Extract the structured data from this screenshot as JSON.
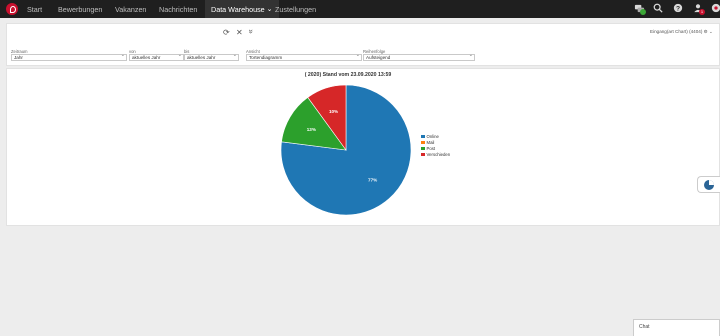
{
  "nav": {
    "items": [
      "Start",
      "Bewerbungen",
      "Vakanzen",
      "Nachrichten",
      "Data Warehouse",
      "Zustellungen"
    ],
    "active_suffix": "⌄"
  },
  "topbar_icons": {
    "status_badge_color": "#3aa635",
    "notification_count": "1",
    "notification_badge_color": "#c8102e"
  },
  "toolbar": {
    "refresh": "⟳",
    "close": "✕",
    "expand": "»",
    "chart_selector": "Eingang(art Chart) (4404) ⚙ ⌄"
  },
  "filters": {
    "zeitraum": {
      "label": "Zeitraum",
      "value": "Jahr"
    },
    "von": {
      "label": "von",
      "value": "aktuelles Jahr"
    },
    "bis": {
      "label": "bis",
      "value": "aktuelles Jahr"
    },
    "ansicht": {
      "label": "Ansicht",
      "value": "Tortendiagramm"
    },
    "reihenfolge": {
      "label": "Reihenfolge",
      "value": "Aufsteigend"
    }
  },
  "chart_data": {
    "type": "pie",
    "title": "( 2020) Stand vom 23.09.2020 13:59",
    "slices": [
      {
        "name": "Online",
        "value": 77,
        "label": "77%",
        "color": "#1f77b4"
      },
      {
        "name": "Mail",
        "value": 0,
        "label": "",
        "color": "#ff7f0e"
      },
      {
        "name": "Post",
        "value": 13,
        "label": "13%",
        "color": "#2ca02c"
      },
      {
        "name": "Verschieden",
        "value": 10,
        "label": "10%",
        "color": "#d62728"
      }
    ],
    "legend_position": "right"
  },
  "side_button": {
    "icon": "pie-chart-icon"
  },
  "chat": {
    "label": "Chat"
  }
}
